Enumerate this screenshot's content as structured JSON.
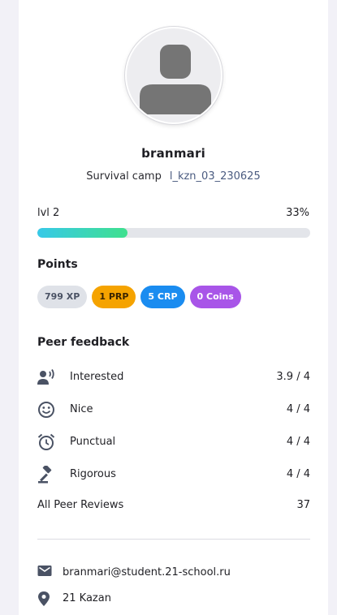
{
  "profile": {
    "username": "branmari",
    "camp": "Survival camp",
    "wave": "l_kzn_03_230625",
    "avatar_icon": "user-silhouette-icon"
  },
  "level": {
    "label": "lvl 2",
    "percent_text": "33%",
    "progress": 0.33
  },
  "points": {
    "title": "Points",
    "badges": [
      {
        "label": "799 XP",
        "bg": "#dfe2e8",
        "fg": "#4a5264"
      },
      {
        "label": "1 PRP",
        "bg": "#f5a300",
        "fg": "#3a2400"
      },
      {
        "label": "5 CRP",
        "bg": "#1a8cf0",
        "fg": "#ffffff"
      },
      {
        "label": "0 Coins",
        "bg": "#a855e8",
        "fg": "#ffffff"
      }
    ]
  },
  "feedback": {
    "title": "Peer feedback",
    "items": [
      {
        "icon": "speaking-person-icon",
        "label": "Interested",
        "value": "3.9 / 4"
      },
      {
        "icon": "smiley-face-icon",
        "label": "Nice",
        "value": "4 / 4"
      },
      {
        "icon": "alarm-clock-icon",
        "label": "Punctual",
        "value": "4 / 4"
      },
      {
        "icon": "gavel-icon",
        "label": "Rigorous",
        "value": "4 / 4"
      }
    ],
    "all_reviews_label": "All Peer Reviews",
    "all_reviews_count": "37"
  },
  "contacts": {
    "email_icon": "mail-icon",
    "email": "branmari@student.21-school.ru",
    "location_icon": "location-pin-icon",
    "location": "21 Kazan"
  },
  "colors": {
    "progress_start": "#37c9e8",
    "progress_end": "#3fe08e",
    "icon": "#4a5264"
  }
}
